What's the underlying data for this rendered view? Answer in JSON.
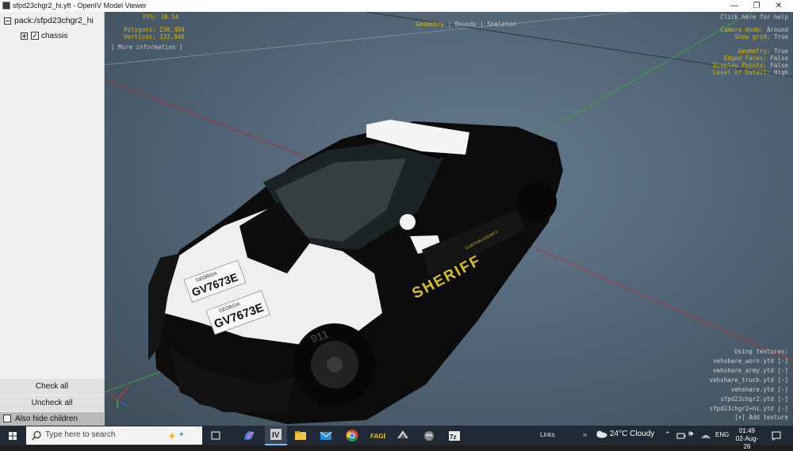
{
  "window": {
    "title": "sfpd23chgr2_hi.yft - OpenIV Model Viewer",
    "controls": [
      "—",
      "❐",
      "✕"
    ]
  },
  "sidebar": {
    "root_label": "pack:/sfpd23chgr2_hi",
    "child_label": "chassis",
    "child_checked": true,
    "check_all": "Check all",
    "uncheck_all": "Uncheck all",
    "hide_children": "Also hide children"
  },
  "viewport": {
    "fps": "FPS: 30.54",
    "polygons": "Polygons: 230,484",
    "vertices": "Vertices: 232,940",
    "more_info": "[ More information ]",
    "modes": {
      "geometry": "Geometry",
      "sep1": "|",
      "bounds": "Bounds",
      "sep2": "|",
      "skeleton": "Skeleton"
    },
    "help": "Click here for help",
    "settings": [
      {
        "label": "Camera mode:",
        "value": "Around"
      },
      {
        "label": "Show grid:",
        "value": "True"
      },
      {
        "label": "Geometry:",
        "value": "True"
      },
      {
        "label": "Edged Faces:",
        "value": "False"
      },
      {
        "label": "Display Points:",
        "value": "False"
      },
      {
        "label": "Level of Detail:",
        "value": "High"
      }
    ],
    "textures_header": "Using textures:",
    "textures": [
      "vehshare_worn.ytd [-]",
      "vehshare_army.ytd [-]",
      "vehshare_truck.ytd [-]",
      "vehshare.ytd [-]",
      "sfpd23chgr2.ytd [-]",
      "sfpd23chgr2+hi.ytd [-]"
    ],
    "add_texture": "[+] Add texture",
    "car": {
      "plate_text": "GV7673E",
      "plate_state": "GEORGIA",
      "door_text": "SHERIFF",
      "county_text": "CLAYTON COUNTY",
      "number_text": "911"
    }
  },
  "taskbar": {
    "search_placeholder": "Type here to search",
    "links": "Links",
    "weather": "24°C  Cloudy",
    "lang": "ENG",
    "time": "01:49",
    "date": "02-Aug-26"
  },
  "colors": {
    "hud_yellow": "#d8b800",
    "hud_green": "#49d65f",
    "viewport_bg": "#5a6e80",
    "taskbar_bg": "#1f2a36"
  }
}
